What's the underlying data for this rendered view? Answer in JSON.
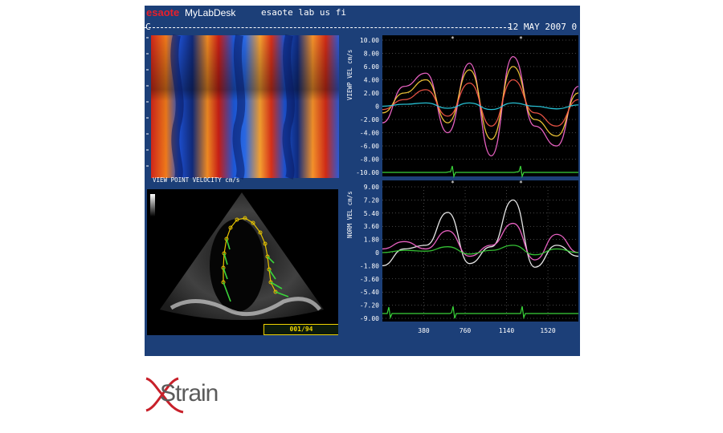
{
  "header": {
    "brand": "esaote",
    "brand_product": "MyLabDesk",
    "host": "esaote lab us fi",
    "date": "12 MAY 2007",
    "date_suffix": "0",
    "corner_mark": "C"
  },
  "top_left_panel": {
    "label": "VIEW POINT VELOCITY cm/s"
  },
  "echo_panel": {
    "frame_counter": "001/94"
  },
  "velocity_chart": {
    "ylabel": "VIEWP VEL cm/s",
    "yticks": [
      "10.00",
      "8.00",
      "6.00",
      "4.00",
      "2.00",
      "0",
      "-2.00",
      "-4.00",
      "-6.00",
      "-8.00",
      "-10.00"
    ],
    "markers": [
      "*",
      "*"
    ]
  },
  "normalized_chart": {
    "ylabel": "NORM VEL cm/s",
    "yticks": [
      "9.00",
      "7.20",
      "5.40",
      "3.60",
      "1.80",
      "0",
      "-1.80",
      "-3.60",
      "-5.40",
      "-7.20",
      "-9.00"
    ],
    "xticks": [
      "380",
      "760",
      "1140",
      "1520"
    ],
    "markers": [
      "*",
      "*"
    ]
  },
  "footer": {
    "logo_text": "Strain"
  },
  "colors": {
    "screen_bg": "#1c3f78",
    "ecg": "#3ad43a",
    "logo_red": "#c8202a",
    "logo_gray": "#5b5b5b"
  },
  "chart_data": [
    {
      "type": "line",
      "title": "",
      "ylabel": "VIEWP VEL cm/s",
      "ylim": [
        -10,
        10
      ],
      "xlim": [
        0,
        1800
      ],
      "yticks": [
        10,
        8,
        6,
        4,
        2,
        0,
        -2,
        -4,
        -6,
        -8,
        -10
      ],
      "series": [
        {
          "x": [
            0,
            200,
            400,
            600,
            800,
            1000,
            1200,
            1400,
            1600,
            1800
          ],
          "y": [
            -2.5,
            3.0,
            5.0,
            -4.0,
            6.5,
            -7.5,
            7.5,
            -3.0,
            -6.0,
            3.0
          ]
        },
        {
          "x": [
            0,
            200,
            400,
            600,
            800,
            1000,
            1200,
            1400,
            1600,
            1800
          ],
          "y": [
            -1.0,
            2.0,
            4.0,
            -2.5,
            5.5,
            -5.0,
            6.0,
            -2.0,
            -4.5,
            2.0
          ]
        },
        {
          "x": [
            0,
            200,
            400,
            600,
            800,
            1000,
            1200,
            1400,
            1600,
            1800
          ],
          "y": [
            -0.5,
            1.0,
            2.5,
            -1.5,
            3.5,
            -3.0,
            4.0,
            -1.0,
            -3.0,
            1.0
          ]
        },
        {
          "x": [
            0,
            200,
            400,
            600,
            800,
            1000,
            1200,
            1400,
            1600,
            1800
          ],
          "y": [
            0.0,
            0.3,
            0.5,
            -0.3,
            0.5,
            -0.5,
            0.5,
            0.0,
            -0.4,
            0.2
          ]
        }
      ]
    },
    {
      "type": "line",
      "title": "",
      "ylabel": "NORM VEL cm/s",
      "ylim": [
        -9,
        9
      ],
      "xlim": [
        0,
        1800
      ],
      "yticks": [
        9,
        7.2,
        5.4,
        3.6,
        1.8,
        0,
        -1.8,
        -3.6,
        -5.4,
        -7.2,
        -9
      ],
      "xticks": [
        380,
        760,
        1140,
        1520
      ],
      "series": [
        {
          "x": [
            0,
            200,
            400,
            600,
            800,
            1000,
            1200,
            1400,
            1600,
            1800
          ],
          "y": [
            -1.8,
            0.5,
            1.0,
            5.5,
            -1.5,
            0.8,
            7.2,
            -2.0,
            1.0,
            -0.5
          ]
        },
        {
          "x": [
            0,
            200,
            400,
            600,
            800,
            1000,
            1200,
            1400,
            1600,
            1800
          ],
          "y": [
            0.5,
            1.5,
            0.5,
            3.0,
            -0.5,
            1.0,
            4.0,
            -1.0,
            2.5,
            0.0
          ]
        },
        {
          "x": [
            0,
            200,
            400,
            600,
            800,
            1000,
            1200,
            1400,
            1600,
            1800
          ],
          "y": [
            0.0,
            0.3,
            0.2,
            0.8,
            -0.2,
            0.3,
            1.0,
            -0.3,
            0.5,
            0.0
          ]
        }
      ]
    }
  ]
}
